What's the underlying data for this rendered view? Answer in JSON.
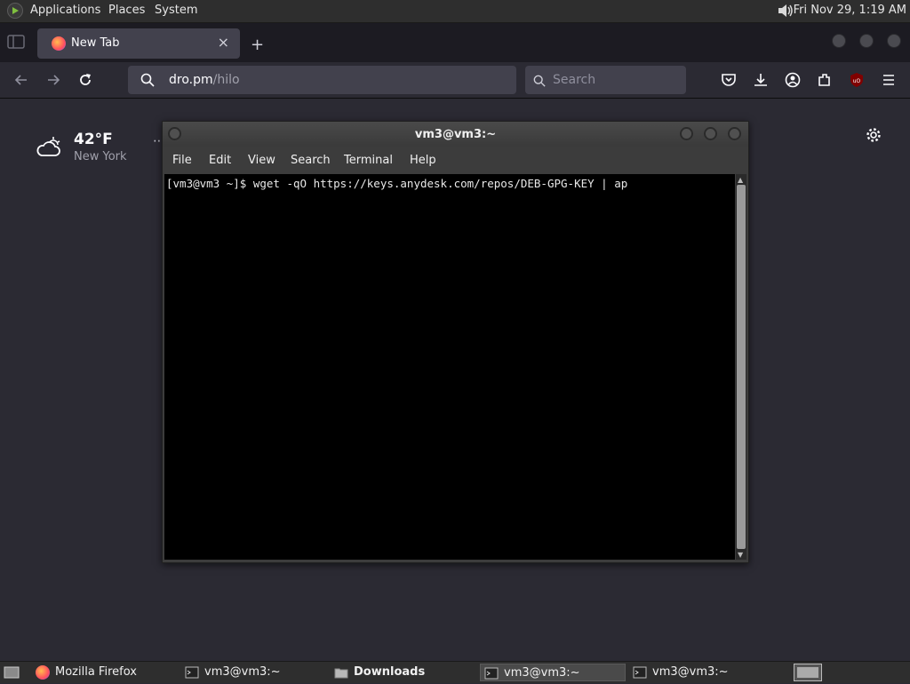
{
  "topbar": {
    "menus": [
      "Applications",
      "Places",
      "System"
    ],
    "clock": "Fri Nov 29,  1:19 AM"
  },
  "browser": {
    "tab_title": "New Tab",
    "url_domain": "dro.pm",
    "url_path": "/hilo",
    "search_placeholder": "Search",
    "weather": {
      "temperature": "42°F",
      "city": "New York"
    }
  },
  "terminal": {
    "title": "vm3@vm3:~",
    "menus": [
      "File",
      "Edit",
      "View",
      "Search",
      "Terminal",
      "Help"
    ],
    "line": "[vm3@vm3 ~]$ wget -qO https://keys.anydesk.com/repos/DEB-GPG-KEY | ap"
  },
  "taskbar": {
    "items": [
      {
        "label": "Mozilla Firefox",
        "icon": "firefox-icon"
      },
      {
        "label": "vm3@vm3:~",
        "icon": "terminal-icon"
      },
      {
        "label": "Downloads",
        "icon": "folder-icon"
      },
      {
        "label": "vm3@vm3:~",
        "icon": "terminal-icon"
      },
      {
        "label": "vm3@vm3:~",
        "icon": "terminal-icon"
      }
    ]
  }
}
